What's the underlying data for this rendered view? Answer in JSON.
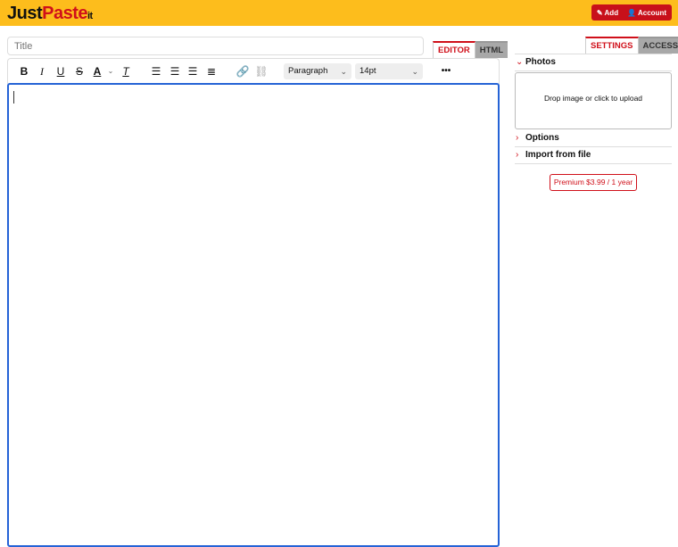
{
  "header": {
    "logo_just": "Just",
    "logo_paste": "Paste",
    "logo_it": "it",
    "add_label": "Add",
    "account_label": "Account"
  },
  "editor": {
    "title_placeholder": "Title",
    "tab_editor": "EDITOR",
    "tab_html": "HTML",
    "block_format": "Paragraph",
    "font_size": "14pt",
    "more": "•••"
  },
  "sidebar": {
    "tab_settings": "SETTINGS",
    "tab_access": "ACCESS",
    "photos": "Photos",
    "drop_text": "Drop image or click to upload",
    "options": "Options",
    "import": "Import from file",
    "premium": "Premium $3.99 / 1 year"
  },
  "colors": {
    "brand_yellow": "#fdbd1c",
    "brand_red": "#d0101a",
    "focus_blue": "#2563d6",
    "inactive_tab_gray": "#a8a8a8"
  }
}
